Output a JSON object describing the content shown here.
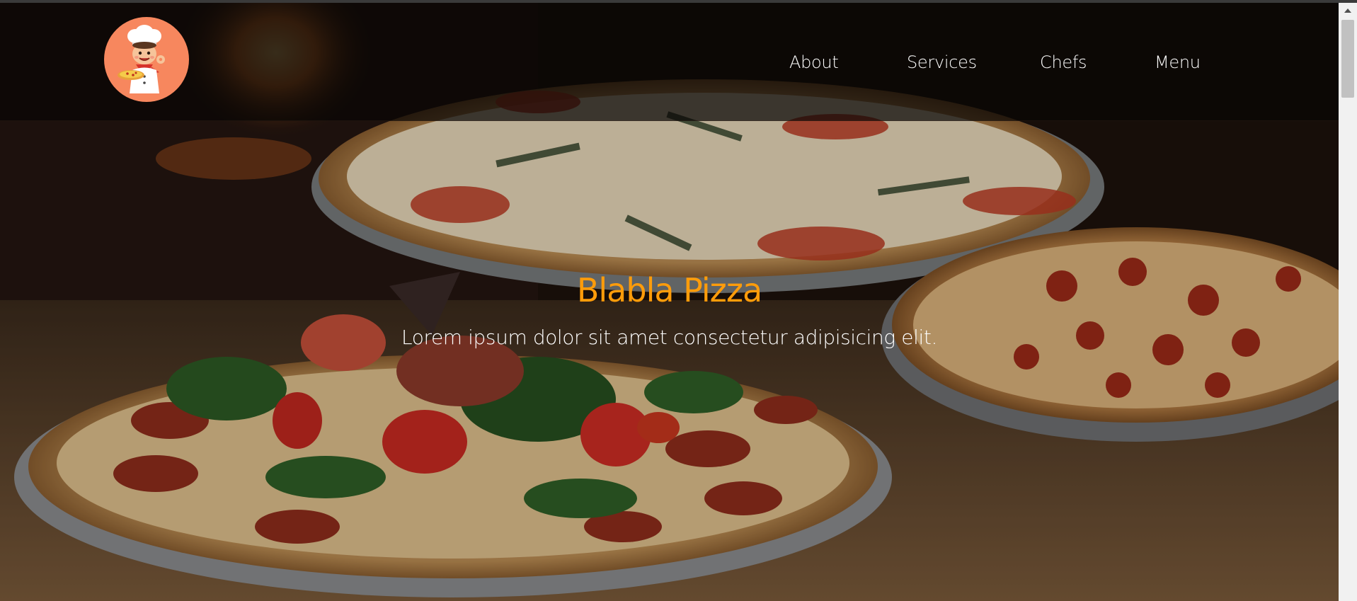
{
  "header": {
    "logo_alt": "Chef mascot logo",
    "nav": [
      "About",
      "Services",
      "Chefs",
      "Menu"
    ]
  },
  "hero": {
    "title": "Blabla Pizza",
    "subtitle": "Lorem ipsum dolor sit amet consectetur adipisicing elit."
  },
  "colors": {
    "accent": "#ff9c0a",
    "logo_bg": "#f7875e",
    "header_bg": "#0a0605"
  },
  "icons": {
    "logo": "chef-mascot-icon",
    "scroll_up": "arrow-up-icon"
  }
}
